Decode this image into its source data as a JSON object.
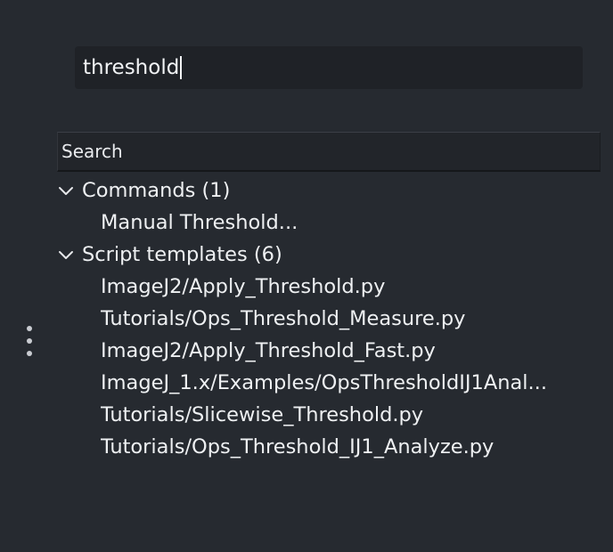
{
  "query": {
    "value": "threshold"
  },
  "search_bar": {
    "label": "Search"
  },
  "groups": [
    {
      "label": "Commands (1)",
      "items": [
        "Manual Threshold..."
      ]
    },
    {
      "label": "Script templates (6)",
      "items": [
        "ImageJ2/Apply_Threshold.py",
        "Tutorials/Ops_Threshold_Measure.py",
        "ImageJ2/Apply_Threshold_Fast.py",
        "ImageJ_1.x/Examples/OpsThresholdIJ1Anal...",
        "Tutorials/Slicewise_Threshold.py",
        "Tutorials/Ops_Threshold_IJ1_Analyze.py"
      ]
    }
  ],
  "icons": {
    "group_toggle": "chevron-down-icon",
    "side_handle": "more-vertical-icon"
  },
  "colors": {
    "background": "#262a30",
    "query_field": "#1f2227",
    "search_bar": "#22252a",
    "text": "#eef0f2"
  }
}
